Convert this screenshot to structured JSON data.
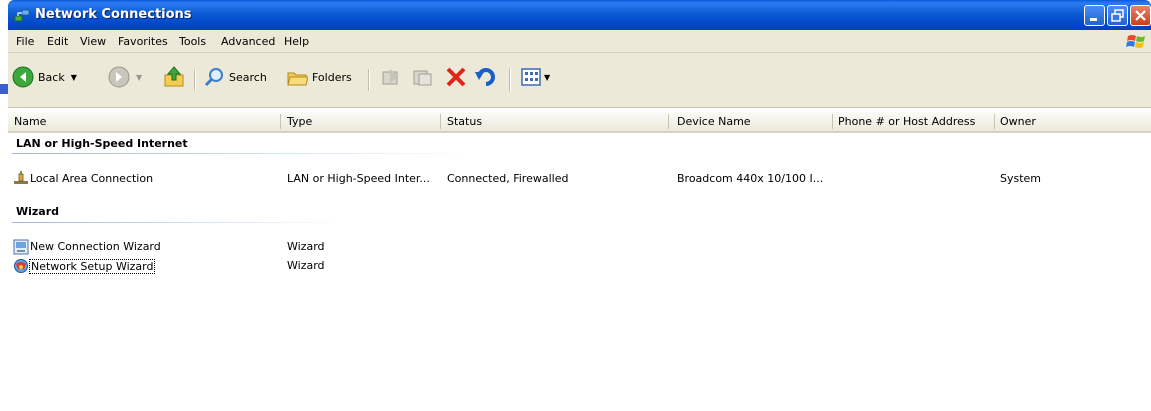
{
  "window": {
    "title": "Network Connections",
    "buttons": [
      "minimize",
      "maximize",
      "close"
    ]
  },
  "menu": [
    "File",
    "Edit",
    "View",
    "Favorites",
    "Tools",
    "Advanced",
    "Help"
  ],
  "toolbar": {
    "back_label": "Back",
    "search_label": "Search",
    "folders_label": "Folders"
  },
  "columns": [
    "Name",
    "Type",
    "Status",
    "Device Name",
    "Phone # or Host Address",
    "Owner"
  ],
  "groups": [
    {
      "title": "LAN or High-Speed Internet",
      "items": [
        {
          "name": "Local Area Connection",
          "type": "LAN or High-Speed Inter...",
          "status": "Connected, Firewalled",
          "device": "Broadcom 440x 10/100 I...",
          "phone": "",
          "owner": "System",
          "icon": "lan-connection-icon"
        }
      ]
    },
    {
      "title": "Wizard",
      "items": [
        {
          "name": "New Connection Wizard",
          "type": "Wizard",
          "icon": "new-connection-wizard-icon"
        },
        {
          "name": "Network Setup Wizard",
          "type": "Wizard",
          "icon": "network-setup-wizard-icon"
        }
      ]
    }
  ],
  "colors": {
    "titlebar": "#0a52d6",
    "chrome": "#ece9d8",
    "close": "#d2491f"
  }
}
